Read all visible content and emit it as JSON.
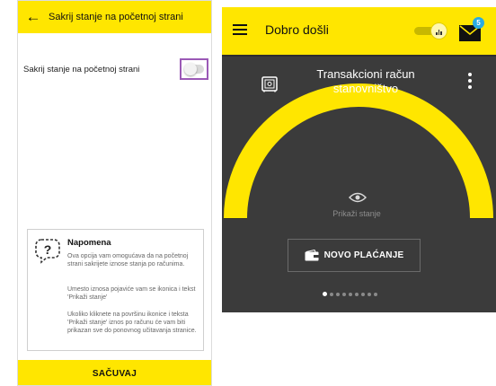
{
  "settings_screen": {
    "back_icon": "arrow-left-icon",
    "title": "Sakrij stanje na početnoj strani",
    "option_label": "Sakrij stanje na početnoj strani",
    "option_enabled": false,
    "note": {
      "icon": "speech-bubble-question-icon",
      "title": "Napomena",
      "paragraph1": "Ova opcija vam omogućava da na početnoj strani sakrijete iznose stanja po računima.",
      "paragraph2": "Umesto iznosa pojaviće vam se ikonica i tekst 'Prikaži stanje'",
      "paragraph3": "Ukoliko kliknete na površinu ikonice i teksta 'Prikaži stanje' iznos po računu će vam biti prikazan sve do ponovnog učitavanja stranice."
    },
    "save_label": "SAČUVAJ"
  },
  "home_screen": {
    "menu_icon": "hamburger-menu-icon",
    "greeting": "Dobro došli",
    "mail_badge": "5",
    "account": {
      "icon": "safe-icon",
      "title": "Transakcioni račun stanovništvo",
      "show_balance_label": "Prikaži stanje",
      "eye_icon": "eye-icon"
    },
    "new_payment_label": "NOVO PLAĆANJE",
    "carousel": {
      "active_index": 0,
      "total": 9
    }
  },
  "colors": {
    "brand_yellow": "#ffe600",
    "dark_card": "#3b3b3b",
    "toggle_highlight": "#9b59b6",
    "badge_blue": "#29abe2"
  }
}
